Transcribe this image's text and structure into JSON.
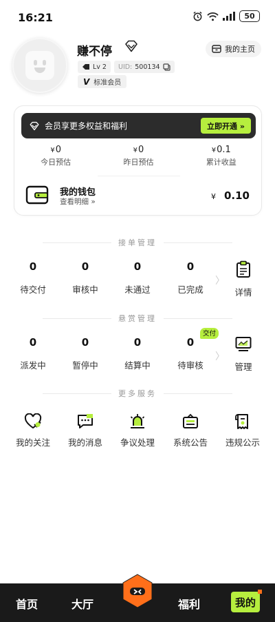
{
  "status_bar": {
    "time": "16:21",
    "battery": "50"
  },
  "profile": {
    "username": "赚不停",
    "level": "Lv 2",
    "uid_label": "UID:",
    "uid": "500134",
    "membership": "标准会员",
    "membership_mark": "V",
    "homepage_label": "我的主页"
  },
  "card": {
    "vip_text": "会员享更多权益和福利",
    "vip_button": "立即开通 »",
    "currency": "¥",
    "earnings": [
      {
        "value": "0",
        "label": "今日预估"
      },
      {
        "value": "0",
        "label": "昨日预估"
      },
      {
        "value": "0.1",
        "label": "累计收益"
      }
    ],
    "wallet": {
      "title": "我的钱包",
      "subtitle": "查看明细 »",
      "amount": "0.10"
    }
  },
  "sections": {
    "orders_title": "接单管理",
    "bounty_title": "悬赏管理",
    "more_title": "更多服务"
  },
  "orders": {
    "items": [
      {
        "count": "0",
        "label": "待交付"
      },
      {
        "count": "0",
        "label": "审核中"
      },
      {
        "count": "0",
        "label": "未通过"
      },
      {
        "count": "0",
        "label": "已完成"
      }
    ],
    "tool_label": "详情"
  },
  "bounty": {
    "items": [
      {
        "count": "0",
        "label": "派发中"
      },
      {
        "count": "0",
        "label": "暂停中"
      },
      {
        "count": "0",
        "label": "结算中"
      },
      {
        "count": "0",
        "label": "待审核"
      }
    ],
    "tag": "交付",
    "tool_label": "管理"
  },
  "services": [
    {
      "label": "我的关注",
      "icon": "heart-icon"
    },
    {
      "label": "我的消息",
      "icon": "message-icon"
    },
    {
      "label": "争议处理",
      "icon": "siren-icon"
    },
    {
      "label": "系统公告",
      "icon": "notice-icon"
    },
    {
      "label": "违规公示",
      "icon": "receipt-icon"
    }
  ],
  "tabbar": {
    "home": "首页",
    "hall": "大厅",
    "welfare": "福利",
    "mine": "我的"
  },
  "colors": {
    "accent": "#b6ee3e",
    "dark": "#1a1a1a",
    "orange": "#ff6f1a"
  }
}
